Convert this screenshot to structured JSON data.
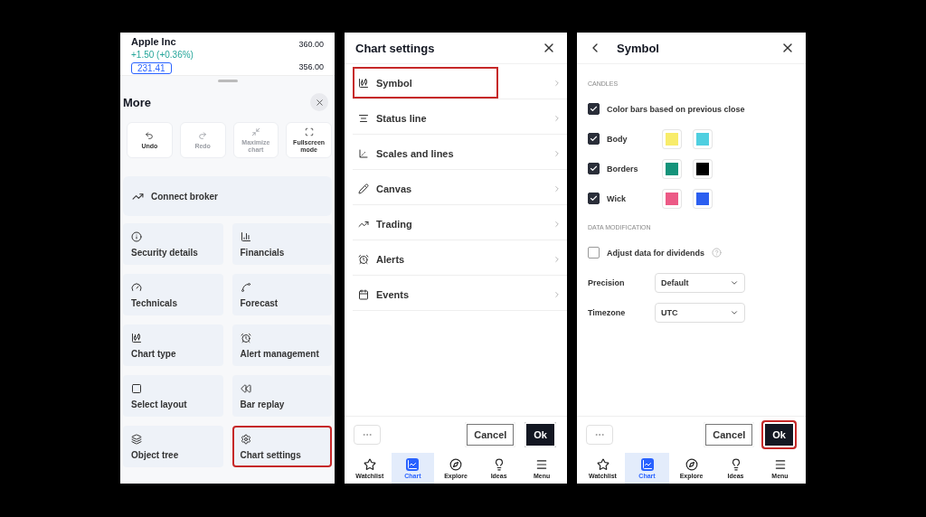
{
  "more_panel": {
    "quote": {
      "symbol": "Apple Inc",
      "change": "+1.50 (+0.36%)",
      "price_tag": "231.41",
      "scale": [
        "360.00",
        "356.00"
      ]
    },
    "title": "More",
    "actions": [
      {
        "label": "Undo",
        "disabled": false
      },
      {
        "label": "Redo",
        "disabled": true
      },
      {
        "label": "Maximize chart",
        "disabled": true
      },
      {
        "label": "Fullscreen mode",
        "disabled": false
      }
    ],
    "connect": "Connect broker",
    "items": [
      {
        "label": "Security details",
        "highlighted": false
      },
      {
        "label": "Financials",
        "highlighted": false
      },
      {
        "label": "Technicals",
        "highlighted": false
      },
      {
        "label": "Forecast",
        "highlighted": false
      },
      {
        "label": "Chart type",
        "highlighted": false
      },
      {
        "label": "Alert management",
        "highlighted": false
      },
      {
        "label": "Select layout",
        "highlighted": false
      },
      {
        "label": "Bar replay",
        "highlighted": false
      },
      {
        "label": "Object tree",
        "highlighted": false
      },
      {
        "label": "Chart settings",
        "highlighted": true
      }
    ]
  },
  "chart_settings_panel": {
    "title": "Chart settings",
    "rows": [
      {
        "label": "Symbol",
        "highlighted": true
      },
      {
        "label": "Status line",
        "highlighted": false
      },
      {
        "label": "Scales and lines",
        "highlighted": false
      },
      {
        "label": "Canvas",
        "highlighted": false
      },
      {
        "label": "Trading",
        "highlighted": false
      },
      {
        "label": "Alerts",
        "highlighted": false
      },
      {
        "label": "Events",
        "highlighted": false
      }
    ],
    "buttons": [
      {
        "label": "Cancel",
        "kind": "secondary",
        "highlighted": false
      },
      {
        "label": "Ok",
        "kind": "primary",
        "highlighted": false
      }
    ],
    "bottom_nav": [
      {
        "label": "Watchlist",
        "selected": false
      },
      {
        "label": "Chart",
        "selected": true
      },
      {
        "label": "Explore",
        "selected": false
      },
      {
        "label": "Ideas",
        "selected": false
      },
      {
        "label": "Menu",
        "selected": false
      }
    ]
  },
  "symbol_panel": {
    "title": "Symbol",
    "candles_heading": "CANDLES",
    "color_bars": {
      "label": "Color bars based on previous close",
      "checked": true
    },
    "candle_rows": [
      {
        "label": "Body",
        "checked": true,
        "swatches": [
          {
            "color": "#f8ec6a"
          },
          {
            "color": "#4fcfe0"
          }
        ]
      },
      {
        "label": "Borders",
        "checked": true,
        "swatches": [
          {
            "color": "#14937a"
          },
          {
            "color": "#000000"
          }
        ]
      },
      {
        "label": "Wick",
        "checked": true,
        "swatches": [
          {
            "color": "#ec5a86"
          },
          {
            "color": "#2c5ff0"
          }
        ]
      }
    ],
    "data_heading": "DATA MODIFICATION",
    "adjust": {
      "label": "Adjust data for dividends",
      "checked": false
    },
    "selects": [
      {
        "label": "Precision",
        "value": "Default"
      },
      {
        "label": "Timezone",
        "value": "UTC"
      }
    ],
    "buttons": [
      {
        "label": "Cancel",
        "kind": "secondary",
        "highlighted": false
      },
      {
        "label": "Ok",
        "kind": "primary",
        "highlighted": true
      }
    ],
    "bottom_nav": [
      {
        "label": "Watchlist",
        "selected": false
      },
      {
        "label": "Chart",
        "selected": true
      },
      {
        "label": "Explore",
        "selected": false
      },
      {
        "label": "Ideas",
        "selected": false
      },
      {
        "label": "Menu",
        "selected": false
      }
    ]
  }
}
